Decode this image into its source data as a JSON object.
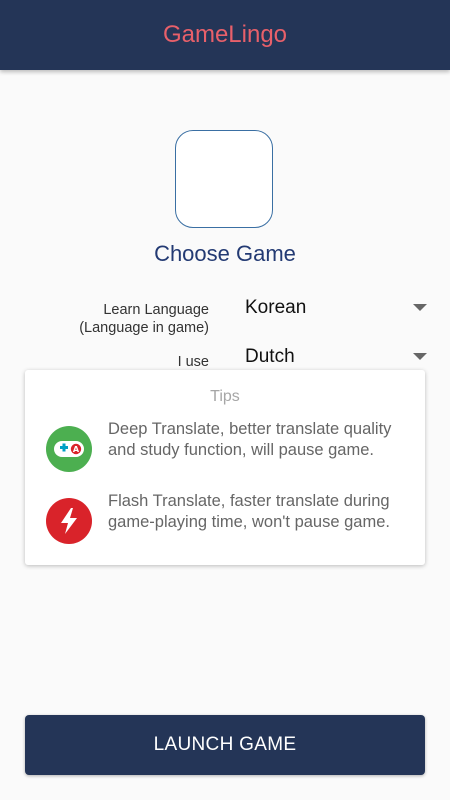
{
  "app": {
    "title": "GameLingo",
    "title_color": "#e8606a",
    "bar_color": "#243557"
  },
  "game_picker": {
    "label": "Choose Game"
  },
  "learn_language": {
    "label_line1": "Learn Language",
    "label_line2": "(Language in game)",
    "value": "Korean"
  },
  "i_use": {
    "label": "I use",
    "value": "Dutch"
  },
  "tips": {
    "title": "Tips",
    "items": [
      {
        "icon": "gamepad-icon",
        "icon_color": "#4caf50",
        "text": "Deep Translate, better translate quality and study function, will pause game."
      },
      {
        "icon": "lightning-icon",
        "icon_color": "#d9232a",
        "text": "Flash Translate, faster translate during game-playing time, won't pause game."
      }
    ]
  },
  "launch": {
    "label": "LAUNCH GAME"
  }
}
